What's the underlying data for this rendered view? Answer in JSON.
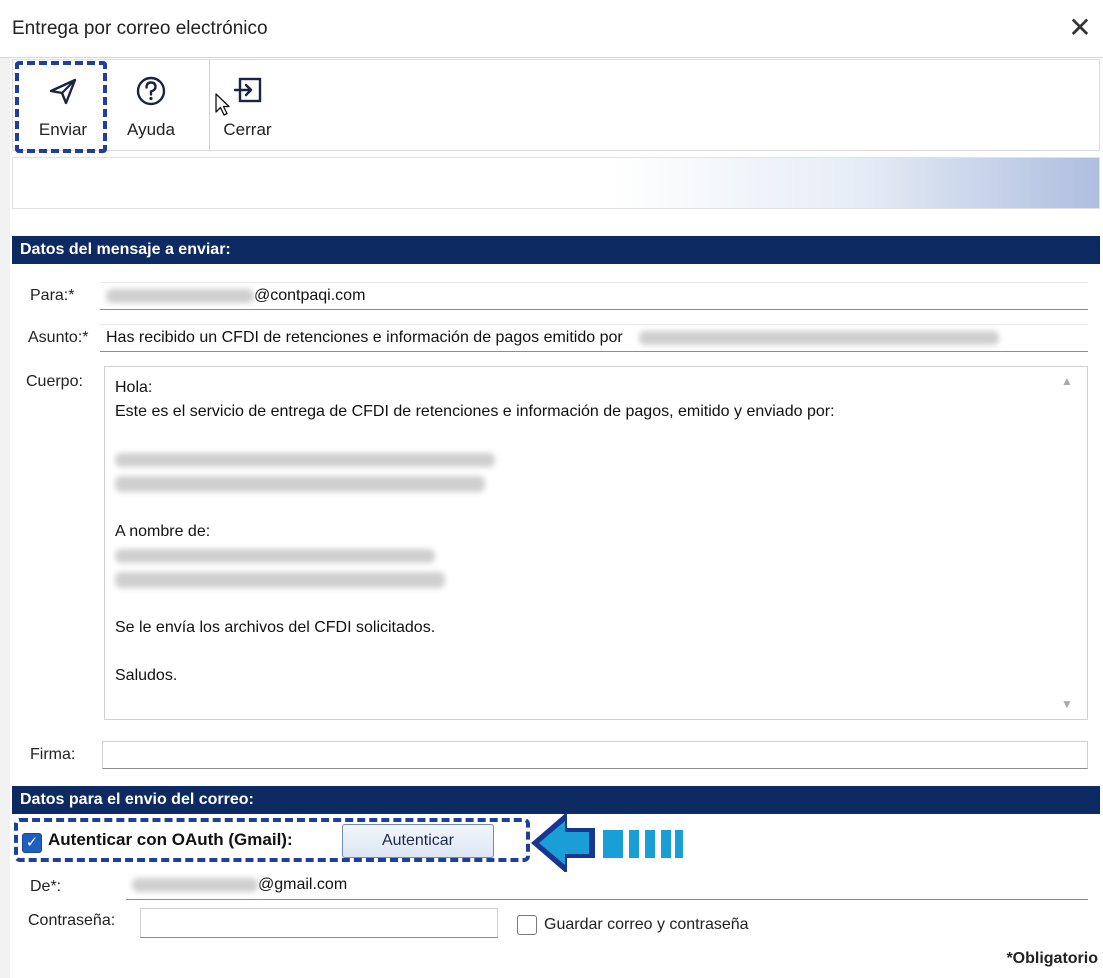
{
  "window": {
    "title": "Entrega por correo electrónico",
    "close_glyph": "✕"
  },
  "toolbar": {
    "enviar": {
      "label": "Enviar",
      "icon": "send-icon"
    },
    "ayuda": {
      "label": "Ayuda",
      "icon": "help-icon"
    },
    "cerrar": {
      "label": "Cerrar",
      "icon": "exit-icon"
    }
  },
  "sections": {
    "mensaje": "Datos del mensaje a enviar:",
    "envio": "Datos para el envio del correo:"
  },
  "form": {
    "para_label": "Para:*",
    "para_value": "@contpaqi.com",
    "asunto_label": "Asunto:*",
    "asunto_value": "Has recibido un CFDI de retenciones e información de pagos emitido por",
    "cuerpo_label": "Cuerpo:",
    "cuerpo_lines": {
      "l1": "Hola:",
      "l2": "Este es el servicio de entrega de CFDI de retenciones e información de pagos, emitido y enviado por:",
      "l3": "A nombre de:",
      "l4": "Se le envía los archivos del CFDI solicitados.",
      "l5": "Saludos."
    },
    "firma_label": "Firma:",
    "firma_value": ""
  },
  "auth": {
    "checked": true,
    "label": "Autenticar con OAuth (Gmail):",
    "button": "Autenticar",
    "de_label": "De*:",
    "de_value": "@gmail.com",
    "password_label": "Contraseña:",
    "password_value": "",
    "save_label": "Guardar correo y contraseña",
    "save_checked": false
  },
  "footer": {
    "required_note": "*Obligatorio"
  },
  "colors": {
    "section_bg": "#0e2a63",
    "highlight": "#1f3f9e",
    "arrow": "#1a9ed8"
  }
}
